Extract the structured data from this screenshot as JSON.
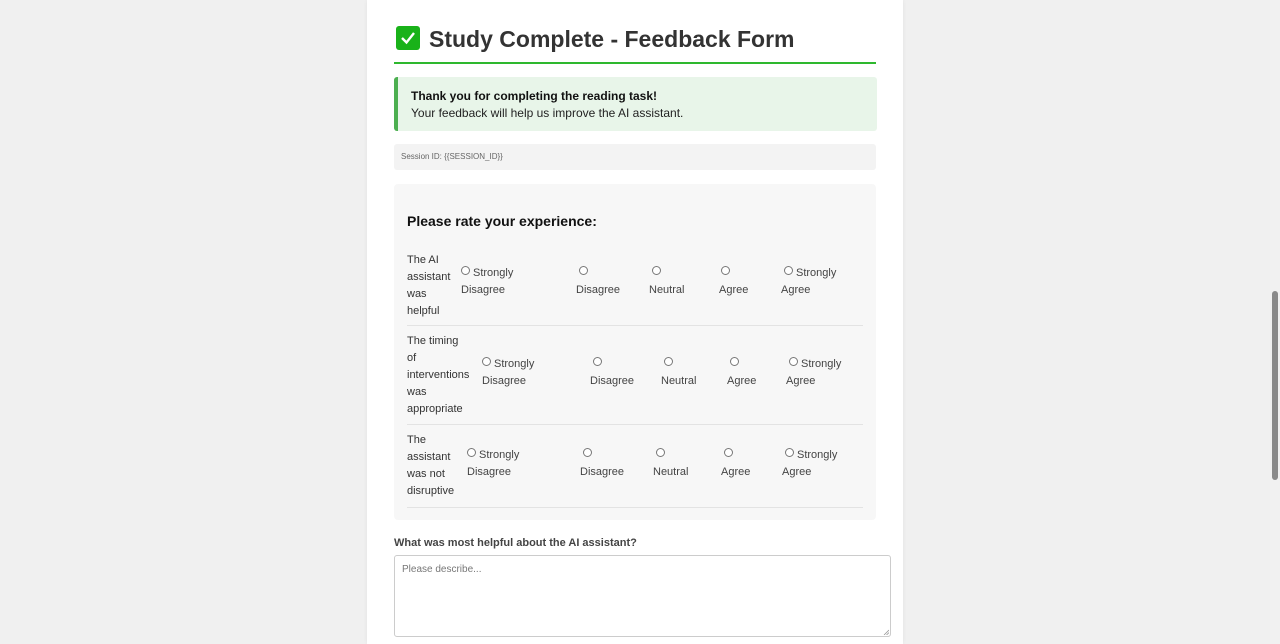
{
  "header": {
    "icon": "check-mark-icon",
    "title": "Study Complete - Feedback Form",
    "accent": "#2eb82e"
  },
  "thanks": {
    "line1": "Thank you for completing the reading task!",
    "line2": "Your feedback will help us improve the AI assistant."
  },
  "session": {
    "text": "Session ID: {{SESSION_ID}}"
  },
  "ratings": {
    "title": "Please rate your experience:",
    "questions": [
      {
        "label_lines": [
          "The AI",
          "assistant",
          "was",
          "helpful"
        ],
        "options": [
          {
            "line1": "Strongly",
            "line2": "Disagree"
          },
          {
            "line1": "",
            "line2": "Disagree"
          },
          {
            "line1": "",
            "line2": "Neutral"
          },
          {
            "line1": "",
            "line2": "Agree"
          },
          {
            "line1": "Strongly",
            "line2": "Agree"
          }
        ]
      },
      {
        "label_lines": [
          "The timing",
          "of",
          "interventions",
          "was",
          "appropriate"
        ],
        "options": [
          {
            "line1": "Strongly",
            "line2": "Disagree"
          },
          {
            "line1": "",
            "line2": "Disagree"
          },
          {
            "line1": "",
            "line2": "Neutral"
          },
          {
            "line1": "",
            "line2": "Agree"
          },
          {
            "line1": "Strongly",
            "line2": "Agree"
          }
        ]
      },
      {
        "label_lines": [
          "The",
          "assistant",
          "was not",
          "disruptive"
        ],
        "options": [
          {
            "line1": "Strongly",
            "line2": "Disagree"
          },
          {
            "line1": "",
            "line2": "Disagree"
          },
          {
            "line1": "",
            "line2": "Neutral"
          },
          {
            "line1": "",
            "line2": "Agree"
          },
          {
            "line1": "Strongly",
            "line2": "Agree"
          }
        ]
      }
    ]
  },
  "helpful": {
    "label": "What was most helpful about the AI assistant?",
    "placeholder": "Please describe..."
  }
}
